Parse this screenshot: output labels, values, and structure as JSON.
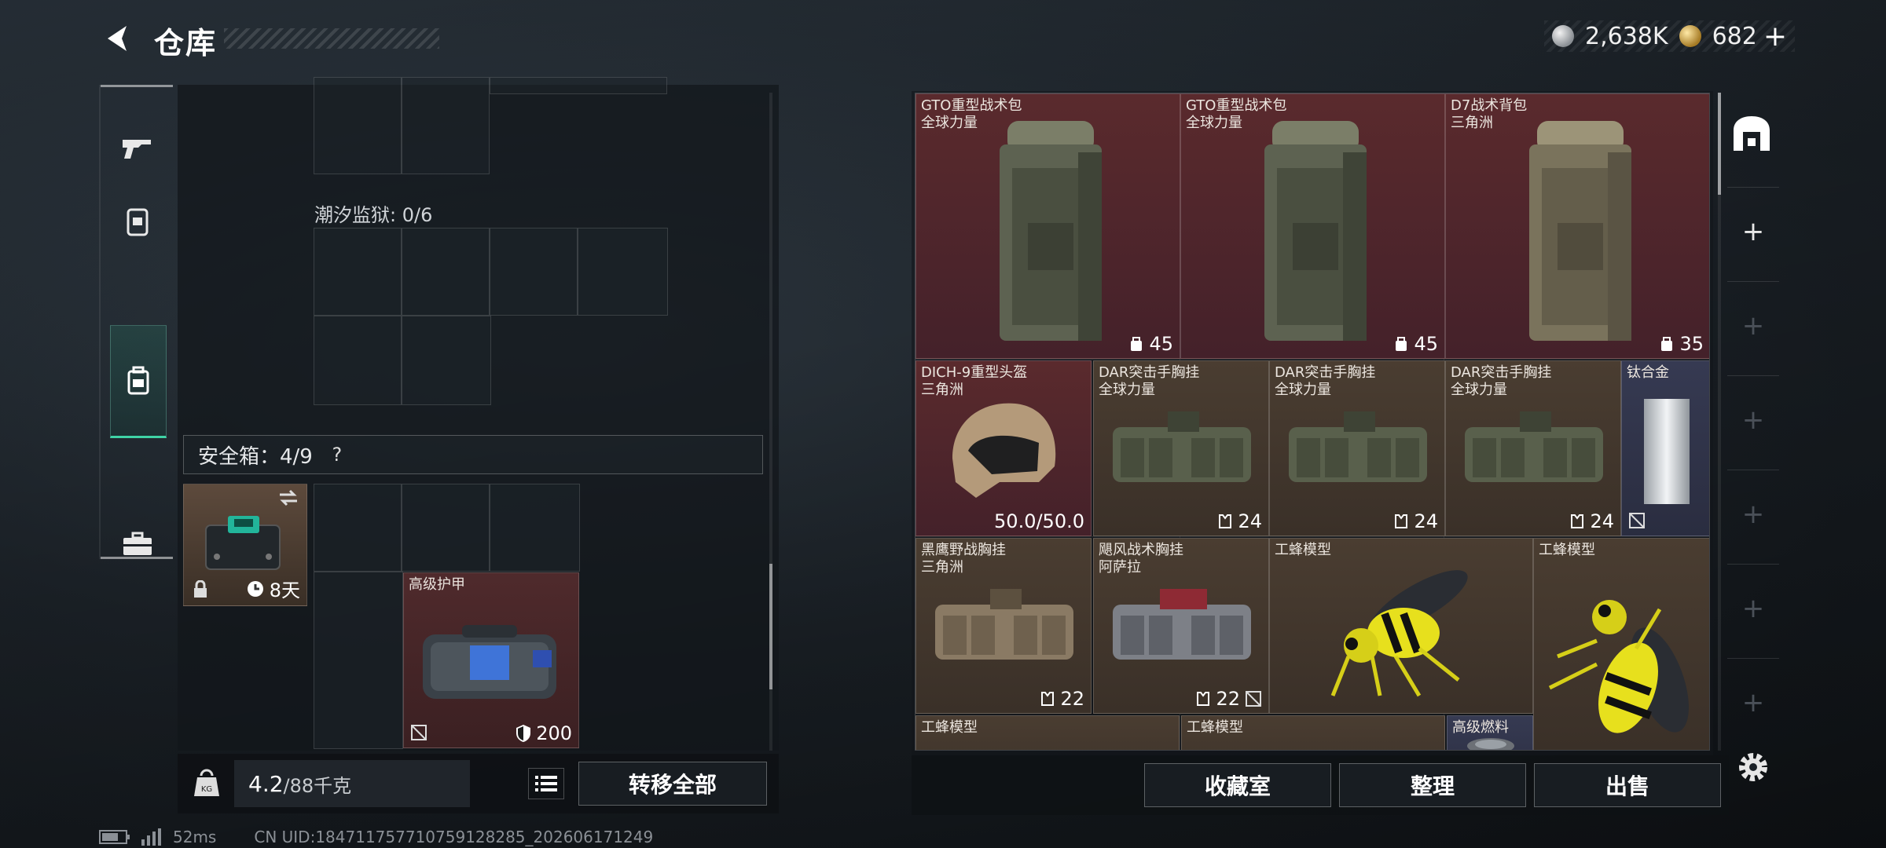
{
  "header": {
    "title": "仓库",
    "currency": {
      "silver": "2,638K",
      "gold": "682",
      "add": "+"
    }
  },
  "left_tabs": [
    "gun-icon",
    "armor-icon",
    "backpack-icon",
    "case-icon"
  ],
  "left_storage": {
    "tide_prison_label": "潮汐监狱: 0/6",
    "safebox_label": "安全箱：4/9",
    "safebox_help": "?",
    "safebox_item": {
      "duration": "8天"
    },
    "armor_item": {
      "name": "高级护甲",
      "durability": "200"
    }
  },
  "left_footer": {
    "weight_value": "4.2",
    "weight_max": "/88千克",
    "transfer_label": "转移全部"
  },
  "status": {
    "ping": "52ms",
    "uid": "CN UID:18471175771075912828​5_202606171249"
  },
  "inventory": {
    "items": [
      {
        "name": "GTO重型战术包",
        "region": "全球力量",
        "count": "45",
        "color": "red"
      },
      {
        "name": "GTO重型战术包",
        "region": "全球力量",
        "count": "45",
        "color": "red"
      },
      {
        "name": "D7战术背包",
        "region": "三角洲",
        "count": "35",
        "color": "red"
      },
      {
        "name": "DICH-9重型头盔",
        "region": "三角洲",
        "count": "50.0/50.0",
        "color": "red"
      },
      {
        "name": "DAR突击手胸挂",
        "region": "全球力量",
        "count": "24",
        "color": "brown"
      },
      {
        "name": "DAR突击手胸挂",
        "region": "全球力量",
        "count": "24",
        "color": "brown"
      },
      {
        "name": "DAR突击手胸挂",
        "region": "全球力量",
        "count": "24",
        "color": "brown"
      },
      {
        "name": "钛合金",
        "region": "",
        "count": "",
        "color": "blue"
      },
      {
        "name": "黑鹰野战胸挂",
        "region": "三角洲",
        "count": "22",
        "color": "brown"
      },
      {
        "name": "飓风战术胸挂",
        "region": "阿萨拉",
        "count": "22",
        "color": "brown"
      },
      {
        "name": "工蜂模型",
        "region": "",
        "count": "",
        "color": "brown"
      },
      {
        "name": "工蜂模型",
        "region": "",
        "count": "",
        "color": "brown"
      },
      {
        "name": "工蜂模型",
        "region": "",
        "count": "",
        "color": "brown"
      },
      {
        "name": "工蜂模型",
        "region": "",
        "count": "",
        "color": "brown"
      },
      {
        "name": "高级燃料",
        "region": "",
        "count": "",
        "color": "blue"
      }
    ]
  },
  "right_footer": {
    "collection_label": "收藏室",
    "sort_label": "整理",
    "sell_label": "出售"
  },
  "colors": {
    "accent": "#3fd3a6",
    "red_item": "#5a2a2d",
    "brown_item": "#4a3d31",
    "blue_item": "#363a52"
  }
}
